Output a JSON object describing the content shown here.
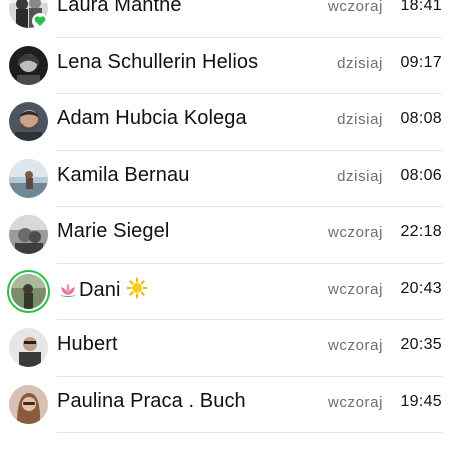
{
  "chats": [
    {
      "name": "Laura Manthe",
      "day": "wczoraj",
      "time": "18:41",
      "avatar_icon": "avatar-photo",
      "status_badge": "green-heart-icon"
    },
    {
      "name": "Lena Schullerin Helios",
      "day": "dzisiaj",
      "time": "09:17",
      "avatar_icon": "avatar-photo"
    },
    {
      "name": "Adam Hubcia Kolega",
      "day": "dzisiaj",
      "time": "08:08",
      "avatar_icon": "avatar-photo"
    },
    {
      "name": "Kamila Bernau",
      "day": "dzisiaj",
      "time": "08:06",
      "avatar_icon": "avatar-photo"
    },
    {
      "name": "Marie Siegel",
      "day": "wczoraj",
      "time": "22:18",
      "avatar_icon": "avatar-photo"
    },
    {
      "name": "Dani",
      "name_prefix_emoji": "lotus-emoji",
      "name_suffix_emoji": "sun-emoji",
      "day": "wczoraj",
      "time": "20:43",
      "avatar_icon": "avatar-photo",
      "status_ring_color": "#25c24a"
    },
    {
      "name": "Hubert",
      "day": "wczoraj",
      "time": "20:35",
      "avatar_icon": "avatar-photo"
    },
    {
      "name": "Paulina Praca . Buch",
      "day": "wczoraj",
      "time": "19:45",
      "avatar_icon": "avatar-photo"
    }
  ],
  "colors": {
    "name_text": "#111111",
    "day_text": "#6e6e73",
    "divider": "#e5e5ea",
    "status_green": "#25c24a"
  }
}
